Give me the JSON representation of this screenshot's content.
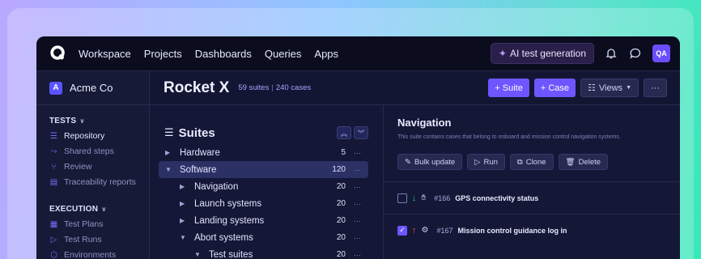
{
  "topbar": {
    "nav": [
      "Workspace",
      "Projects",
      "Dashboards",
      "Queries",
      "Apps"
    ],
    "ai_button": "AI test generation",
    "avatar": "QA"
  },
  "sidebar": {
    "org_badge": "A",
    "org_name": "Acme Co",
    "tests_header": "TESTS",
    "tests_items": [
      {
        "label": "Repository",
        "icon": "list-icon"
      },
      {
        "label": "Shared steps",
        "icon": "shared-steps-icon"
      },
      {
        "label": "Review",
        "icon": "branch-icon"
      },
      {
        "label": "Traceability reports",
        "icon": "report-icon"
      }
    ],
    "execution_header": "EXECUTION",
    "execution_items": [
      {
        "label": "Test Plans",
        "icon": "grid-icon"
      },
      {
        "label": "Test Runs",
        "icon": "play-icon"
      },
      {
        "label": "Environments",
        "icon": "cube-icon"
      }
    ]
  },
  "header": {
    "project": "Rocket X",
    "suites_count": "59 suites",
    "cases_count": "240 cases",
    "suite_button": "+ Suite",
    "case_button": "+ Case",
    "views_button": "Views"
  },
  "suites": {
    "title": "Suites",
    "tree": [
      {
        "label": "Hardware",
        "count": "5",
        "expanded": false,
        "level": 0
      },
      {
        "label": "Software",
        "count": "120",
        "expanded": true,
        "level": 0,
        "selected": true
      },
      {
        "label": "Navigation",
        "count": "20",
        "expanded": false,
        "level": 1
      },
      {
        "label": "Launch systems",
        "count": "20",
        "expanded": false,
        "level": 1
      },
      {
        "label": "Landing systems",
        "count": "20",
        "expanded": false,
        "level": 1
      },
      {
        "label": "Abort systems",
        "count": "20",
        "expanded": true,
        "level": 1
      },
      {
        "label": "Test suites",
        "count": "20",
        "expanded": true,
        "level": 2
      }
    ]
  },
  "detail": {
    "title": "Navigation",
    "description": "This suite contains cases that belong to onboard and mission control navigation systems.",
    "bulk_update": "Bulk update",
    "run": "Run",
    "clone": "Clone",
    "delete": "Delete",
    "cases": [
      {
        "id": "#166",
        "name": "GPS connectivity status",
        "checked": false,
        "priority": "down"
      },
      {
        "id": "#167",
        "name": "Mission control guidance log in",
        "checked": true,
        "priority": "up"
      }
    ]
  },
  "colors": {
    "accent": "#6d56ff",
    "priority_low": "#34c98c",
    "priority_high": "#ff4a6a"
  }
}
